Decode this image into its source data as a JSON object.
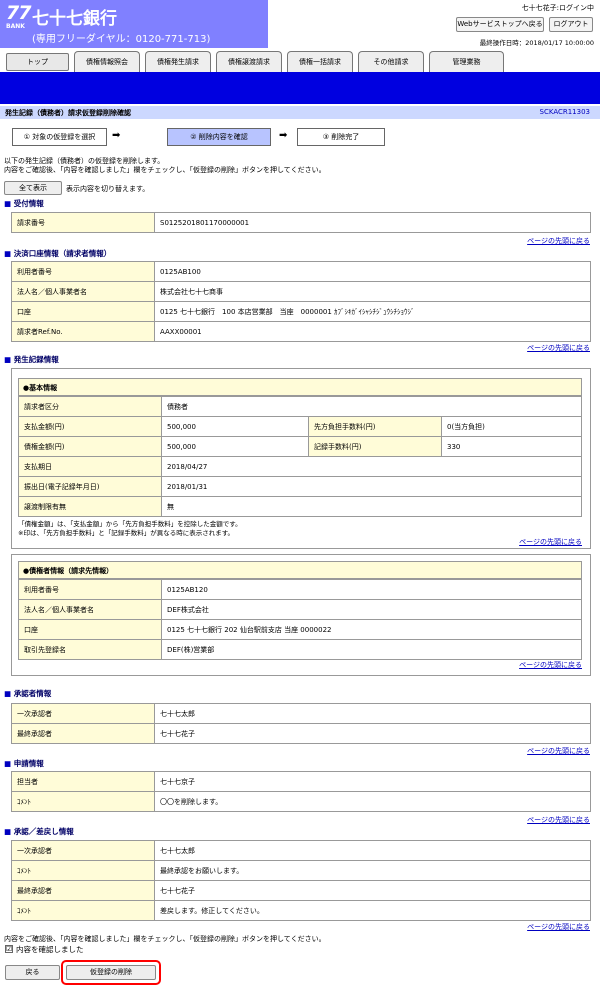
{
  "header": {
    "logo_number": "77",
    "logo_bank": "BANK",
    "bank_name": "七十七銀行",
    "toll_free": "(専用フリーダイヤル：0120-771-713)",
    "user_status": "七十七花子:ログイン中",
    "web_service_top_button": "Webサービストップへ戻る",
    "logout_button": "ログアウト",
    "last_operation": "最終操作日時：2018/01/17 10:00:00"
  },
  "tabs": [
    "トップ",
    "債権情報照会",
    "債権発生請求",
    "債権譲渡請求",
    "債権一括請求",
    "その他請求",
    "管理業務"
  ],
  "title": {
    "text": "発生記録（債務者）請求仮登録削除確認",
    "code": "SCKACR11303"
  },
  "steps": [
    "① 対象の仮登録を選択",
    "② 削除内容を確認",
    "③ 削除完了"
  ],
  "arrow": "➡",
  "intro_line1": "以下の発生記録（債務者）の仮登録を削除します。",
  "intro_line2": "内容をご確認後、「内容を確認しました」欄をチェックし、「仮登録の削除」ボタンを押してください。",
  "show_all_button": "全て表示",
  "show_all_note": "表示内容を切り替えます。",
  "page_top_link": "ページの先頭に戻る",
  "sections": {
    "reception": {
      "title": "受付情報",
      "rows": [
        [
          "請求番号",
          "S0125201801170000001"
        ]
      ]
    },
    "account": {
      "title": "決済口座情報（請求者情報）",
      "rows": [
        [
          "利用者番号",
          "0125AB100"
        ],
        [
          "法人名／個人事業者名",
          "株式会社七十七商事"
        ],
        [
          "口座",
          "0125 七十七銀行　100 本店営業部　当座　0000001 ｶﾌﾞｼｷｶﾞｲｼｬｼﾁｼﾞｭｳｼﾁｼｮｳｼﾞ"
        ],
        [
          "請求者Ref.No.",
          "AAXX00001"
        ]
      ]
    },
    "issuance": {
      "title": "発生記録情報",
      "basic_header": "●基本情報",
      "basic_rows": {
        "category_label": "請求者区分",
        "category_value": "債務者",
        "payment_label": "支払金額(円)",
        "payment_value": "500,000",
        "fee_label": "先方負担手数料(円)",
        "fee_value": "0(当方負担)",
        "claim_label": "債権金額(円)",
        "claim_value": "500,000",
        "record_fee_label": "記録手数料(円)",
        "record_fee_value": "330",
        "due_label": "支払期日",
        "due_value": "2018/04/27",
        "issue_label": "振出日(電子記録年月日)",
        "issue_value": "2018/01/31",
        "restrict_label": "譲渡制限有無",
        "restrict_value": "無"
      },
      "note1": "「債権金額」は、「支払金額」から「先方負担手数料」を控除した金額です。",
      "note2": "※印は、「先方負担手数料」と「記録手数料」が異なる時に表示されます。",
      "creditor_header": "●債権者情報（請求先情報）",
      "creditor_rows": [
        [
          "利用者番号",
          "0125AB120"
        ],
        [
          "法人名／個人事業者名",
          "DEF株式会社"
        ],
        [
          "口座",
          "0125 七十七銀行 202 仙台駅前支店 当座 0000022"
        ],
        [
          "取引先登録名",
          "DEF(株)営業部"
        ]
      ]
    },
    "approver": {
      "title": "承認者情報",
      "rows": [
        [
          "一次承認者",
          "七十七太郎"
        ],
        [
          "最終承認者",
          "七十七花子"
        ]
      ]
    },
    "application": {
      "title": "申請情報",
      "rows": [
        [
          "担当者",
          "七十七京子"
        ],
        [
          "ｺﾒﾝﾄ",
          "〇〇を削除します。"
        ]
      ]
    },
    "approval": {
      "title": "承認／差戻し情報",
      "rows": [
        [
          "一次承認者",
          "七十七太郎"
        ],
        [
          "ｺﾒﾝﾄ",
          "最終承認をお願いします。"
        ],
        [
          "最終承認者",
          "七十七花子"
        ],
        [
          "ｺﾒﾝﾄ",
          "差戻します。修正してください。"
        ]
      ]
    }
  },
  "bottom_instruction": "内容をご確認後、「内容を確認しました」欄をチェックし、「仮登録の削除」ボタンを押してください。",
  "confirm_check": "☑",
  "confirm_label": "内容を確認しました",
  "back_button": "戻る",
  "delete_button": "仮登録の削除",
  "colors": {
    "brand": "#8080ff",
    "nav": "#0000e0",
    "title_bg": "#ccd8ff",
    "label_bg": "#fffcd8",
    "highlight": "#ff0000"
  }
}
